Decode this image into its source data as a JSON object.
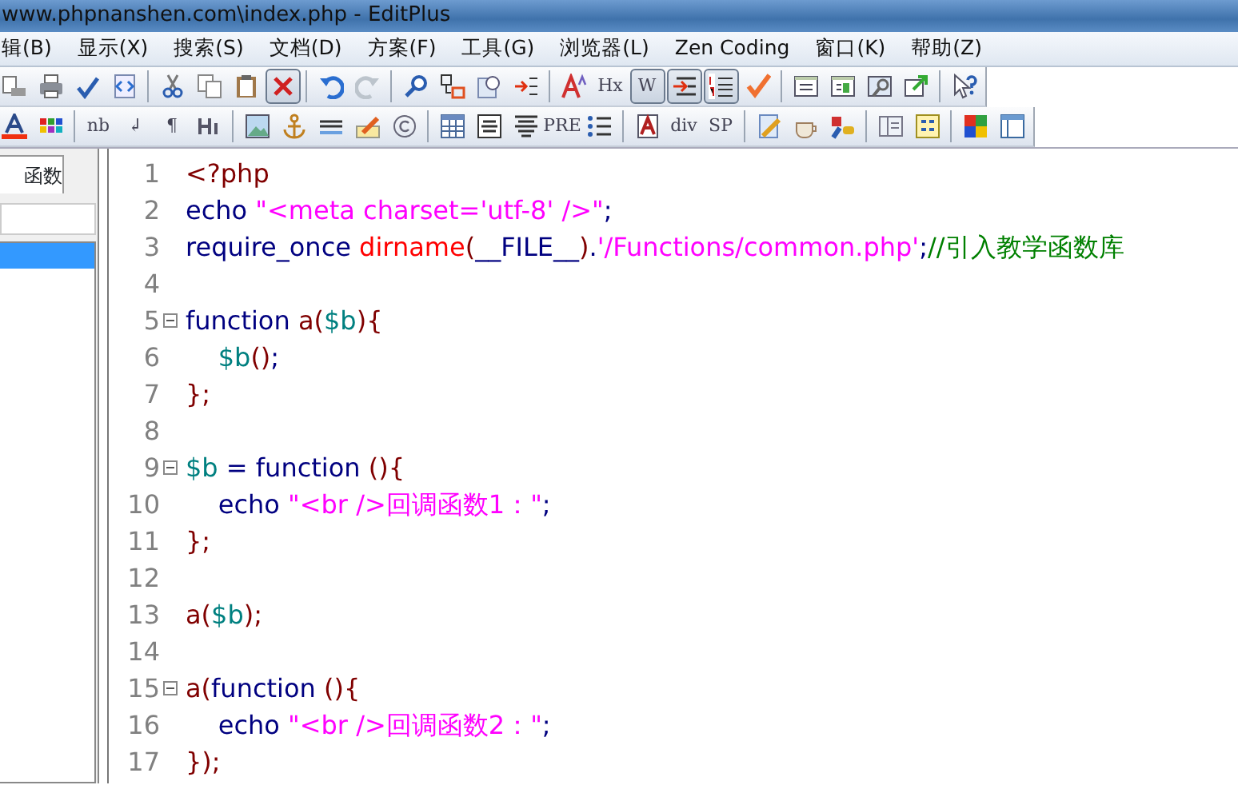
{
  "window": {
    "title": "www.phpnanshen.com\\index.php - EditPlus"
  },
  "menu": [
    "辑(B)",
    "显示(X)",
    "搜索(S)",
    "文档(D)",
    "方案(F)",
    "工具(G)",
    "浏览器(L)",
    "Zen Coding",
    "窗口(K)",
    "帮助(Z)"
  ],
  "toolbars": [
    [
      {
        "kind": "icon",
        "pressed": false
      },
      {
        "kind": "icon",
        "pressed": false
      },
      {
        "kind": "icon",
        "pressed": false
      },
      {
        "kind": "icon",
        "pressed": false
      },
      {
        "kind": "separator"
      },
      {
        "kind": "icon",
        "pressed": false
      },
      {
        "kind": "icon",
        "pressed": false
      },
      {
        "kind": "icon",
        "pressed": false
      },
      {
        "kind": "icon",
        "pressed": true
      },
      {
        "kind": "separator"
      },
      {
        "kind": "icon",
        "pressed": false
      },
      {
        "kind": "icon",
        "pressed": false
      },
      {
        "kind": "separator"
      },
      {
        "kind": "icon",
        "pressed": false
      },
      {
        "kind": "icon",
        "pressed": false
      },
      {
        "kind": "icon",
        "pressed": false
      },
      {
        "kind": "icon",
        "pressed": false
      },
      {
        "kind": "separator"
      },
      {
        "kind": "icon",
        "pressed": false
      },
      {
        "kind": "text",
        "label": "Hx",
        "pressed": false
      },
      {
        "kind": "text",
        "label": "W",
        "pressed": true
      },
      {
        "kind": "icon",
        "pressed": true
      },
      {
        "kind": "icon",
        "pressed": true
      },
      {
        "kind": "icon",
        "pressed": false
      },
      {
        "kind": "separator"
      },
      {
        "kind": "icon",
        "pressed": false
      },
      {
        "kind": "icon",
        "pressed": false
      },
      {
        "kind": "icon",
        "pressed": false
      },
      {
        "kind": "icon",
        "pressed": false
      },
      {
        "kind": "separator"
      },
      {
        "kind": "icon",
        "pressed": false
      }
    ],
    [
      {
        "kind": "icon",
        "pressed": false
      },
      {
        "kind": "icon",
        "pressed": false
      },
      {
        "kind": "separator"
      },
      {
        "kind": "text",
        "label": "nb",
        "pressed": false
      },
      {
        "kind": "text",
        "label": "↲",
        "pressed": false
      },
      {
        "kind": "text",
        "label": "¶",
        "pressed": false
      },
      {
        "kind": "icon",
        "pressed": false
      },
      {
        "kind": "separator"
      },
      {
        "kind": "icon",
        "pressed": false
      },
      {
        "kind": "icon",
        "pressed": false
      },
      {
        "kind": "icon",
        "pressed": false
      },
      {
        "kind": "icon",
        "pressed": false
      },
      {
        "kind": "icon",
        "pressed": false
      },
      {
        "kind": "separator"
      },
      {
        "kind": "icon",
        "pressed": false
      },
      {
        "kind": "icon",
        "pressed": false
      },
      {
        "kind": "icon",
        "pressed": false
      },
      {
        "kind": "text",
        "label": "PRE",
        "pressed": false
      },
      {
        "kind": "icon",
        "pressed": false
      },
      {
        "kind": "separator"
      },
      {
        "kind": "icon",
        "pressed": false
      },
      {
        "kind": "text",
        "label": "div",
        "pressed": false
      },
      {
        "kind": "text",
        "label": "SP",
        "pressed": false
      },
      {
        "kind": "separator"
      },
      {
        "kind": "icon",
        "pressed": false
      },
      {
        "kind": "icon",
        "pressed": false
      },
      {
        "kind": "icon",
        "pressed": false
      },
      {
        "kind": "separator"
      },
      {
        "kind": "icon",
        "pressed": false
      },
      {
        "kind": "icon",
        "pressed": false
      },
      {
        "kind": "separator"
      },
      {
        "kind": "icon",
        "pressed": false
      },
      {
        "kind": "icon",
        "pressed": false
      }
    ]
  ],
  "sidebar": {
    "tab": "函数",
    "items": [
      {
        "selected": true
      }
    ]
  },
  "editor": {
    "lines": [
      {
        "number": "1",
        "fold": false,
        "tokens": [
          {
            "text": "<?php",
            "color": "#800000"
          }
        ]
      },
      {
        "number": "2",
        "fold": false,
        "tokens": [
          {
            "text": "echo ",
            "color": "#000080"
          },
          {
            "text": "\"<meta charset='utf-8' />\"",
            "color": "#ff00ff"
          },
          {
            "text": ";",
            "color": "#000080"
          }
        ]
      },
      {
        "number": "3",
        "fold": false,
        "tokens": [
          {
            "text": "require_once ",
            "color": "#000080"
          },
          {
            "text": "dirname",
            "color": "#ff0000"
          },
          {
            "text": "(",
            "color": "#800000"
          },
          {
            "text": "__FILE__",
            "color": "#000080"
          },
          {
            "text": ")",
            "color": "#800000"
          },
          {
            "text": ".",
            "color": "#000080"
          },
          {
            "text": "'/Functions/common.php'",
            "color": "#ff00ff"
          },
          {
            "text": ";",
            "color": "#000080"
          },
          {
            "text": "//引入教学函数库",
            "color": "#008000"
          }
        ]
      },
      {
        "number": "4",
        "fold": false
      },
      {
        "number": "5",
        "fold": true,
        "tokens": [
          {
            "text": "function ",
            "color": "#000080"
          },
          {
            "text": "a(",
            "color": "#800000"
          },
          {
            "text": "$b",
            "color": "#008080"
          },
          {
            "text": "){",
            "color": "#800000"
          }
        ]
      },
      {
        "number": "6",
        "fold": false,
        "tokens": [
          {
            "text": "    $b",
            "color": "#008080"
          },
          {
            "text": "()",
            "color": "#800000"
          },
          {
            "text": ";",
            "color": "#000080"
          }
        ]
      },
      {
        "number": "7",
        "fold": false,
        "tokens": [
          {
            "text": "};",
            "color": "#800000"
          }
        ]
      },
      {
        "number": "8",
        "fold": false
      },
      {
        "number": "9",
        "fold": true,
        "tokens": [
          {
            "text": "$b",
            "color": "#008080"
          },
          {
            "text": " = function ",
            "color": "#000080"
          },
          {
            "text": "(){",
            "color": "#800000"
          }
        ]
      },
      {
        "number": "10",
        "fold": false,
        "tokens": [
          {
            "text": "    echo ",
            "color": "#000080"
          },
          {
            "text": "\"<br />回调函数1：\"",
            "color": "#ff00ff"
          },
          {
            "text": ";",
            "color": "#000080"
          }
        ]
      },
      {
        "number": "11",
        "fold": false,
        "tokens": [
          {
            "text": "};",
            "color": "#800000"
          }
        ]
      },
      {
        "number": "12",
        "fold": false
      },
      {
        "number": "13",
        "fold": false,
        "tokens": [
          {
            "text": "a(",
            "color": "#800000"
          },
          {
            "text": "$b",
            "color": "#008080"
          },
          {
            "text": ");",
            "color": "#800000"
          }
        ]
      },
      {
        "number": "14",
        "fold": false
      },
      {
        "number": "15",
        "fold": true,
        "tokens": [
          {
            "text": "a(",
            "color": "#800000"
          },
          {
            "text": "function ",
            "color": "#000080"
          },
          {
            "text": "(){",
            "color": "#800000"
          }
        ]
      },
      {
        "number": "16",
        "fold": false,
        "tokens": [
          {
            "text": "    echo ",
            "color": "#000080"
          },
          {
            "text": "\"<br />回调函数2：\"",
            "color": "#ff00ff"
          },
          {
            "text": ";",
            "color": "#000080"
          }
        ]
      },
      {
        "number": "17",
        "fold": false,
        "tokens": [
          {
            "text": "});",
            "color": "#800000"
          }
        ]
      }
    ]
  }
}
